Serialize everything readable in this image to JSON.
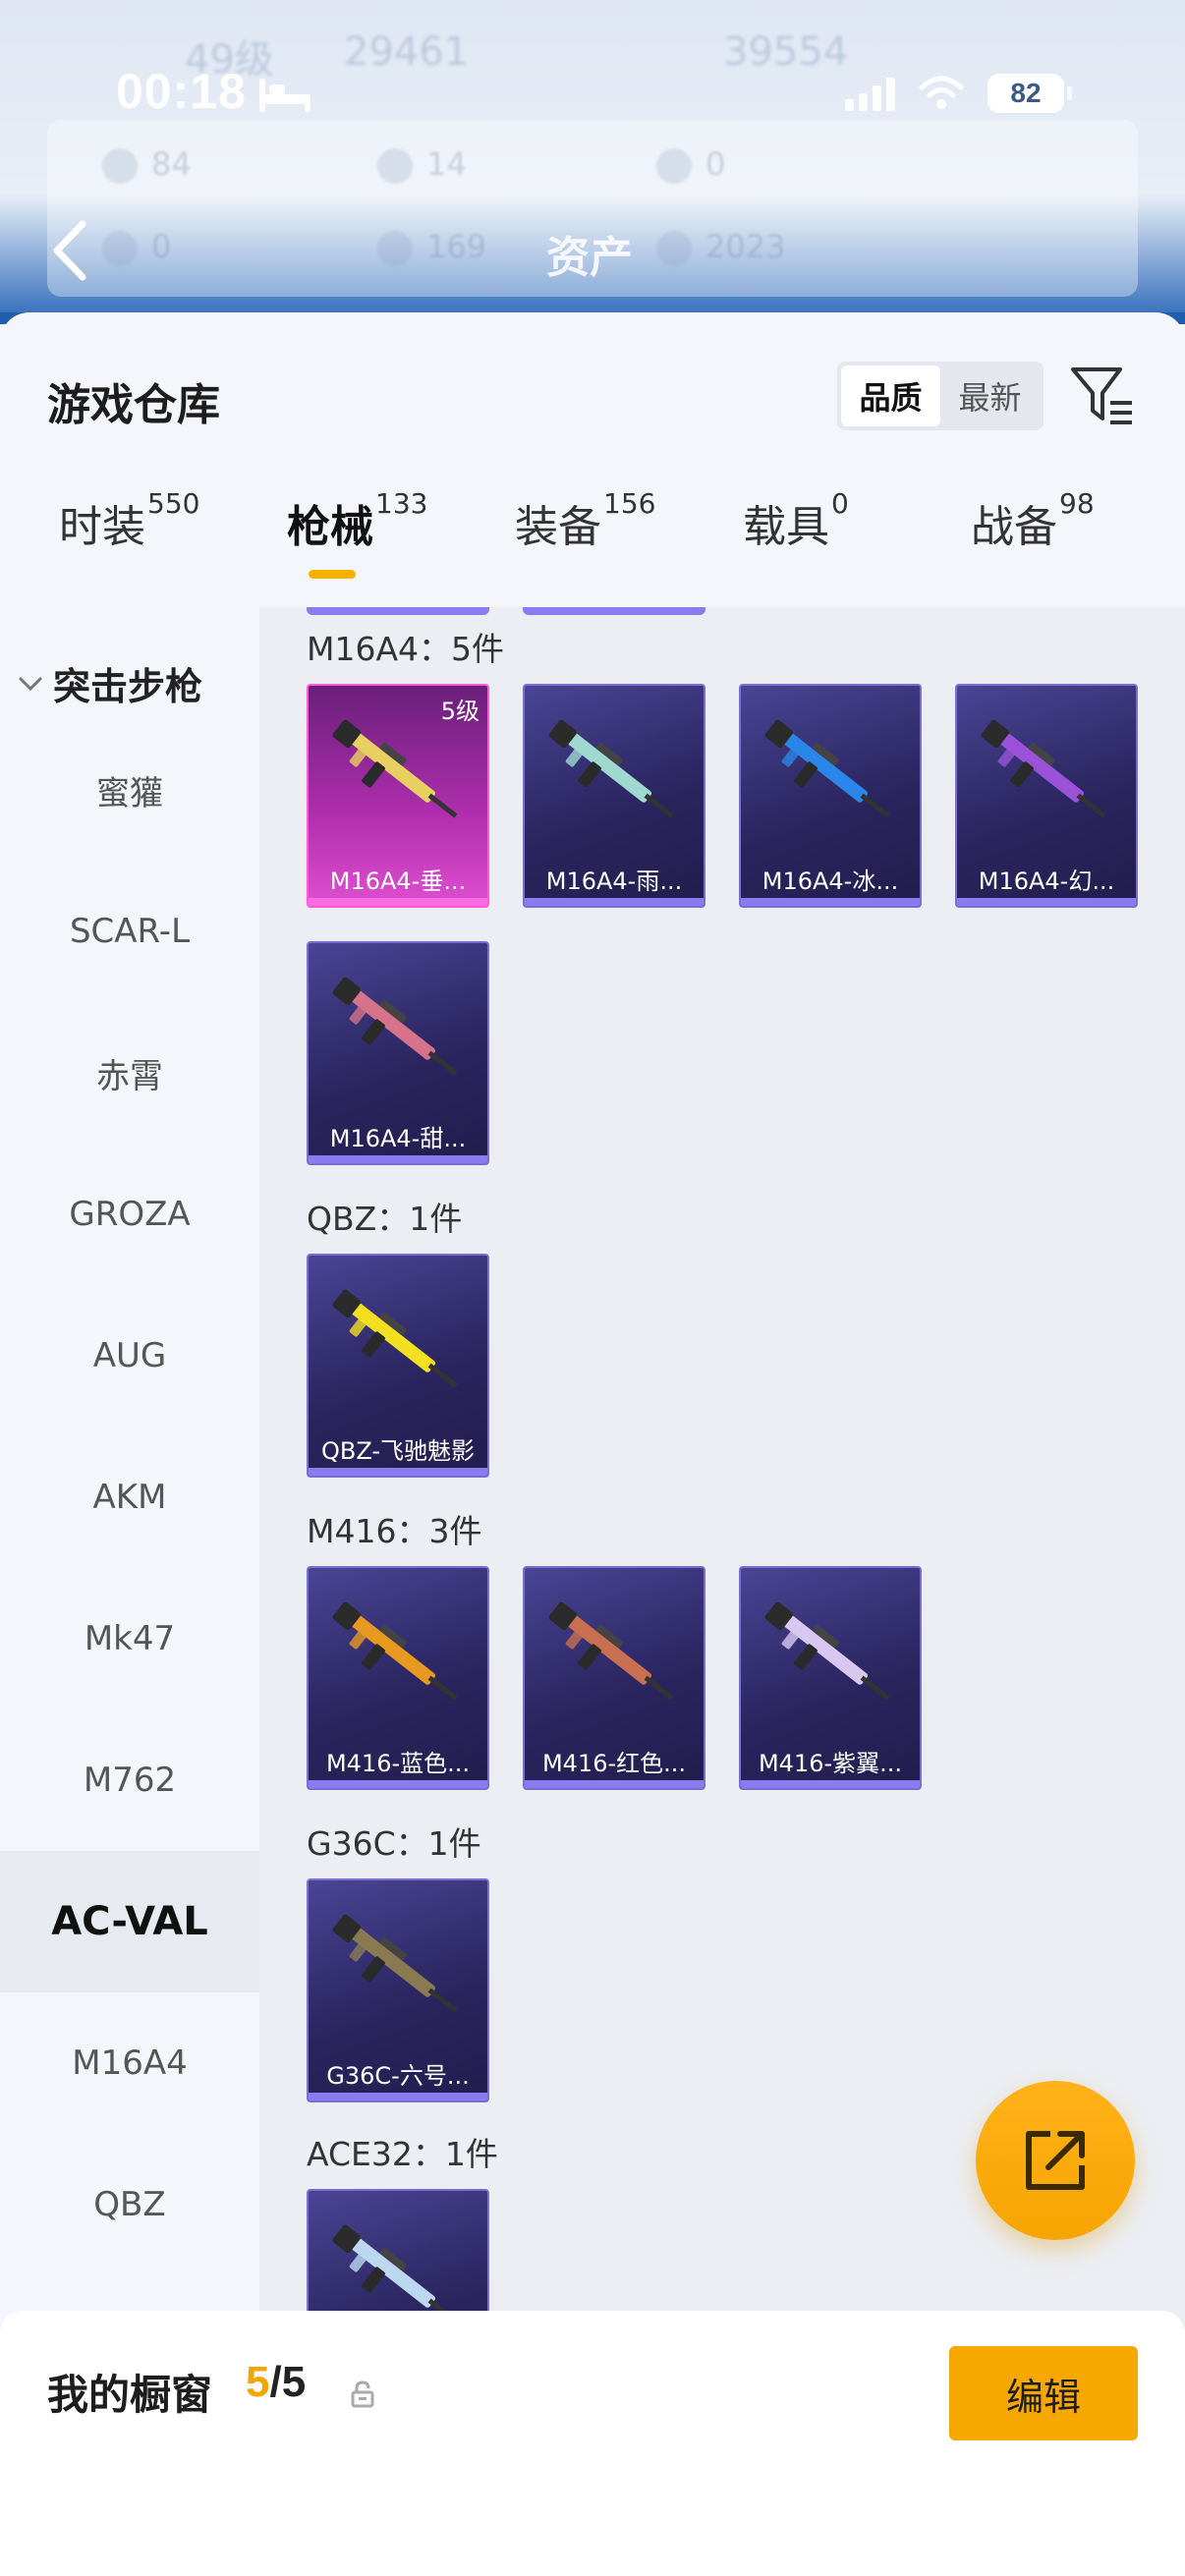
{
  "status": {
    "time": "00:18",
    "battery": "82"
  },
  "header": {
    "title": "资产",
    "ghost_stats": [
      "49级",
      "29461",
      "39554",
      "84",
      "14",
      "0",
      "0",
      "169",
      "2023"
    ]
  },
  "sheet": {
    "title": "游戏仓库",
    "sort_options": [
      "品质",
      "最新"
    ],
    "active_sort": "品质"
  },
  "tabs": [
    {
      "label": "时装",
      "count": "550"
    },
    {
      "label": "枪械",
      "count": "133"
    },
    {
      "label": "装备",
      "count": "156"
    },
    {
      "label": "载具",
      "count": "0"
    },
    {
      "label": "战备",
      "count": "98"
    }
  ],
  "active_tab": "枪械",
  "sidebar": {
    "category": "突击步枪",
    "items": [
      "蜜獾",
      "SCAR-L",
      "赤霄",
      "GROZA",
      "AUG",
      "AKM",
      "Mk47",
      "M762",
      "AC-VAL",
      "M16A4",
      "QBZ"
    ],
    "active": "AC-VAL"
  },
  "sections": [
    {
      "title": "M16A4：5件",
      "cards": [
        {
          "name": "M16A4-垂...",
          "level": "5级",
          "rarity": "pink",
          "color": "#e8d060"
        },
        {
          "name": "M16A4-雨...",
          "rarity": "purple",
          "color": "#9fd8cf"
        },
        {
          "name": "M16A4-冰...",
          "rarity": "purple",
          "color": "#2a86e8"
        },
        {
          "name": "M16A4-幻...",
          "rarity": "purple",
          "color": "#9a52d8"
        },
        {
          "name": "M16A4-甜...",
          "rarity": "purple",
          "color": "#d6728a"
        }
      ]
    },
    {
      "title": "QBZ：1件",
      "cards": [
        {
          "name": "QBZ-飞驰魅影",
          "rarity": "purple",
          "color": "#f2e020"
        }
      ]
    },
    {
      "title": "M416：3件",
      "cards": [
        {
          "name": "M416-蓝色...",
          "rarity": "purple",
          "color": "#e89a20"
        },
        {
          "name": "M416-红色...",
          "rarity": "purple",
          "color": "#c87050"
        },
        {
          "name": "M416-紫翼...",
          "rarity": "purple",
          "color": "#d8c8f0"
        }
      ]
    },
    {
      "title": "G36C：1件",
      "cards": [
        {
          "name": "G36C-六号...",
          "rarity": "purple",
          "color": "#8a7a52"
        }
      ]
    },
    {
      "title": "ACE32：1件",
      "cards": [
        {
          "name": "",
          "rarity": "purple",
          "color": "#bcd8f0"
        }
      ]
    }
  ],
  "showcase": {
    "label": "我的橱窗",
    "current": "5",
    "separator": "/",
    "total": "5",
    "edit_label": "编辑"
  }
}
